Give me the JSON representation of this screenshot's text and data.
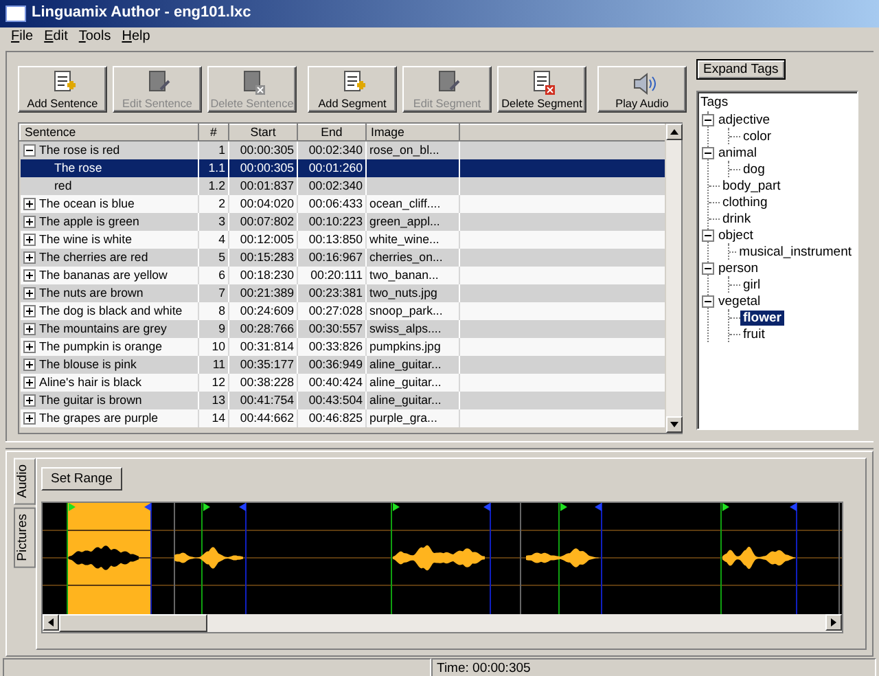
{
  "window": {
    "title": "Linguamix Author - eng101.lxc"
  },
  "menu": [
    {
      "label": "File"
    },
    {
      "label": "Edit"
    },
    {
      "label": "Tools"
    },
    {
      "label": "Help"
    }
  ],
  "toolbar": [
    [
      {
        "label": "Add Sentence",
        "kind": "add",
        "disabled": false
      },
      {
        "label": "Edit Sentence",
        "kind": "edit",
        "disabled": true
      },
      {
        "label": "Delete Sentence",
        "kind": "delete",
        "disabled": true
      }
    ],
    [
      {
        "label": "Add Segment",
        "kind": "add",
        "disabled": false
      },
      {
        "label": "Edit Segment",
        "kind": "edit",
        "disabled": true
      },
      {
        "label": "Delete Segment",
        "kind": "delete",
        "disabled": false
      }
    ],
    [
      {
        "label": "Play Audio",
        "kind": "audio",
        "disabled": false
      }
    ]
  ],
  "table": {
    "columns": [
      "Sentence",
      "#",
      "Start",
      "End",
      "Image"
    ],
    "rows": [
      {
        "sentence": "The rose is red",
        "number": "1",
        "start": "00:00:305",
        "end": "00:02:340",
        "image": "rose_on_bl...",
        "expanded": true,
        "children": [
          {
            "sentence": "The rose",
            "number": "1.1",
            "start": "00:00:305",
            "end": "00:01:260",
            "selected": true
          },
          {
            "sentence": "red",
            "number": "1.2",
            "start": "00:01:837",
            "end": "00:02:340",
            "selected": false
          }
        ]
      },
      {
        "sentence": "The ocean is blue",
        "number": "2",
        "start": "00:04:020",
        "end": "00:06:433",
        "image": "ocean_cliff....",
        "expanded": false
      },
      {
        "sentence": "The apple is green",
        "number": "3",
        "start": "00:07:802",
        "end": "00:10:223",
        "image": "green_appl...",
        "expanded": false
      },
      {
        "sentence": "The wine is white",
        "number": "4",
        "start": "00:12:005",
        "end": "00:13:850",
        "image": "white_wine...",
        "expanded": false
      },
      {
        "sentence": "The cherries are red",
        "number": "5",
        "start": "00:15:283",
        "end": "00:16:967",
        "image": "cherries_on...",
        "expanded": false
      },
      {
        "sentence": "The bananas are yellow",
        "number": "6",
        "start": "00:18:230",
        "end": "00:20:111",
        "image": "two_banan...",
        "expanded": false
      },
      {
        "sentence": "The nuts are brown",
        "number": "7",
        "start": "00:21:389",
        "end": "00:23:381",
        "image": "two_nuts.jpg",
        "expanded": false
      },
      {
        "sentence": "The dog is black and white",
        "number": "8",
        "start": "00:24:609",
        "end": "00:27:028",
        "image": "snoop_park...",
        "expanded": false
      },
      {
        "sentence": "The mountains are grey",
        "number": "9",
        "start": "00:28:766",
        "end": "00:30:557",
        "image": "swiss_alps....",
        "expanded": false
      },
      {
        "sentence": "The pumpkin is orange",
        "number": "10",
        "start": "00:31:814",
        "end": "00:33:826",
        "image": "pumpkins.jpg",
        "expanded": false
      },
      {
        "sentence": "The blouse is pink",
        "number": "11",
        "start": "00:35:177",
        "end": "00:36:949",
        "image": "aline_guitar...",
        "expanded": false
      },
      {
        "sentence": "Aline's hair is black",
        "number": "12",
        "start": "00:38:228",
        "end": "00:40:424",
        "image": "aline_guitar...",
        "expanded": false
      },
      {
        "sentence": "The guitar is brown",
        "number": "13",
        "start": "00:41:754",
        "end": "00:43:504",
        "image": "aline_guitar...",
        "expanded": false
      },
      {
        "sentence": "The grapes are purple",
        "number": "14",
        "start": "00:44:662",
        "end": "00:46:825",
        "image": "purple_gra...",
        "expanded": false
      }
    ]
  },
  "tags": {
    "button": "Expand Tags",
    "root": "Tags",
    "items": [
      {
        "label": "adjective",
        "expanded": true,
        "selected": false,
        "children": [
          {
            "label": "color",
            "selected": false
          }
        ]
      },
      {
        "label": "animal",
        "expanded": true,
        "selected": false,
        "children": [
          {
            "label": "dog",
            "selected": false
          }
        ]
      },
      {
        "label": "body_part",
        "selected": false
      },
      {
        "label": "clothing",
        "selected": false
      },
      {
        "label": "drink",
        "selected": false
      },
      {
        "label": "object",
        "expanded": true,
        "selected": false,
        "children": [
          {
            "label": "musical_instrument",
            "selected": false
          }
        ]
      },
      {
        "label": "person",
        "expanded": true,
        "selected": false,
        "children": [
          {
            "label": "girl",
            "selected": false
          }
        ]
      },
      {
        "label": "vegetal",
        "expanded": true,
        "selected": false,
        "children": [
          {
            "label": "flower",
            "selected": true
          },
          {
            "label": "fruit",
            "selected": false
          }
        ]
      }
    ]
  },
  "bottom_panel": {
    "tabs": [
      {
        "label": "Audio",
        "selected": true
      },
      {
        "label": "Pictures",
        "selected": false
      }
    ],
    "button": "Set Range"
  },
  "status_bar": {
    "time": "Time: 00:00:305"
  }
}
